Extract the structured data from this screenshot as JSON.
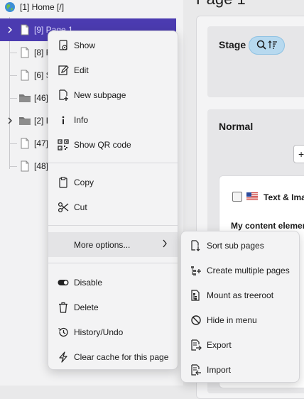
{
  "tree": {
    "items": [
      {
        "label": "[1] Home [/]",
        "icon": "globe-icon"
      },
      {
        "label": "[9] Page 1",
        "icon": "page-icon",
        "selected": true,
        "expandable": true
      },
      {
        "label": "[8] P",
        "icon": "page-icon"
      },
      {
        "label": "[6] S",
        "icon": "page-icon"
      },
      {
        "label": "[46]",
        "icon": "folder-icon"
      },
      {
        "label": "[2] I",
        "icon": "folder-icon",
        "expandable": true
      },
      {
        "label": "[47]",
        "icon": "page-icon"
      },
      {
        "label": "[48]",
        "icon": "page-icon"
      }
    ]
  },
  "main": {
    "page_title": "Page 1",
    "stage_label": "Stage",
    "normal_label": "Normal",
    "add_button": "+",
    "card_title": "Text & Ima",
    "card_sub": "My content elemer"
  },
  "context_menu": {
    "items": [
      {
        "label": "Show",
        "icon": "eye-icon"
      },
      {
        "label": "Edit",
        "icon": "pencil-icon"
      },
      {
        "label": "New subpage",
        "icon": "new-page-icon"
      },
      {
        "label": "Info",
        "icon": "info-icon"
      },
      {
        "label": "Show QR code",
        "icon": "qr-code-icon"
      },
      {
        "label": "Copy",
        "icon": "clipboard-icon"
      },
      {
        "label": "Cut",
        "icon": "scissors-icon"
      },
      {
        "label": "More options...",
        "icon": "",
        "submenu": true
      },
      {
        "label": "Disable",
        "icon": "toggle-icon"
      },
      {
        "label": "Delete",
        "icon": "trash-icon"
      },
      {
        "label": "History/Undo",
        "icon": "history-icon"
      },
      {
        "label": "Clear cache for this page",
        "icon": "lightning-icon"
      }
    ]
  },
  "submenu": {
    "items": [
      {
        "label": "Sort sub pages",
        "icon": "sort-pages-icon"
      },
      {
        "label": "Create multiple pages",
        "icon": "multiple-pages-icon"
      },
      {
        "label": "Mount as treeroot",
        "icon": "treeroot-icon"
      },
      {
        "label": "Hide in menu",
        "icon": "hide-icon"
      },
      {
        "label": "Export",
        "icon": "export-icon"
      },
      {
        "label": "Import",
        "icon": "import-icon"
      }
    ]
  },
  "colors": {
    "selected_row": "#4b3bb0",
    "chip_bg": "#b7d9ef"
  }
}
